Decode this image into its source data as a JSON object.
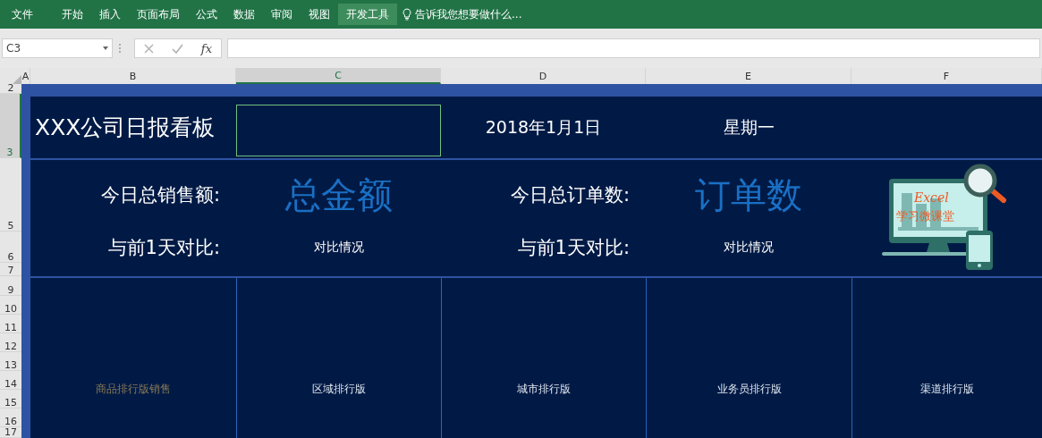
{
  "ribbon": {
    "tabs": [
      {
        "label": "文件",
        "selected": false
      },
      {
        "label": "开始",
        "selected": false
      },
      {
        "label": "插入",
        "selected": false
      },
      {
        "label": "页面布局",
        "selected": false
      },
      {
        "label": "公式",
        "selected": false
      },
      {
        "label": "数据",
        "selected": false
      },
      {
        "label": "审阅",
        "selected": false
      },
      {
        "label": "视图",
        "selected": false
      },
      {
        "label": "开发工具",
        "selected": true
      }
    ],
    "tell_me": "告诉我您想要做什么..."
  },
  "formula_bar": {
    "name_box": "C3",
    "fx": "fx"
  },
  "columns": [
    {
      "label": "A",
      "selected": false
    },
    {
      "label": "B",
      "selected": false
    },
    {
      "label": "C",
      "selected": true
    },
    {
      "label": "D",
      "selected": false
    },
    {
      "label": "E",
      "selected": false
    },
    {
      "label": "F",
      "selected": false
    }
  ],
  "rows": [
    {
      "label": "2",
      "selected": false
    },
    {
      "label": "3",
      "selected": true
    },
    {
      "label": "5",
      "selected": false
    },
    {
      "label": "6",
      "selected": false
    },
    {
      "label": "7",
      "selected": false
    },
    {
      "label": "9",
      "selected": false
    },
    {
      "label": "10",
      "selected": false
    },
    {
      "label": "11",
      "selected": false
    },
    {
      "label": "12",
      "selected": false
    },
    {
      "label": "13",
      "selected": false
    },
    {
      "label": "14",
      "selected": false
    },
    {
      "label": "15",
      "selected": false
    },
    {
      "label": "16",
      "selected": false
    },
    {
      "label": "17",
      "selected": false
    }
  ],
  "dashboard": {
    "title": "XXX公司日报看板",
    "date": "2018年1月1日",
    "weekday": "星期一",
    "metrics": [
      {
        "label": "今日总销售额:",
        "value": "总金额",
        "compare_label": "与前1天对比:",
        "compare_value": "对比情况"
      },
      {
        "label": "今日总订单数:",
        "value": "订单数",
        "compare_label": "与前1天对比:",
        "compare_value": "对比情况"
      }
    ],
    "logo": {
      "title": "Excel",
      "subtitle": "学习微课堂"
    },
    "rankings": [
      "商品排行版销售",
      "区域排行版",
      "城市排行版",
      "业务员排行版",
      "渠道排行版"
    ]
  }
}
